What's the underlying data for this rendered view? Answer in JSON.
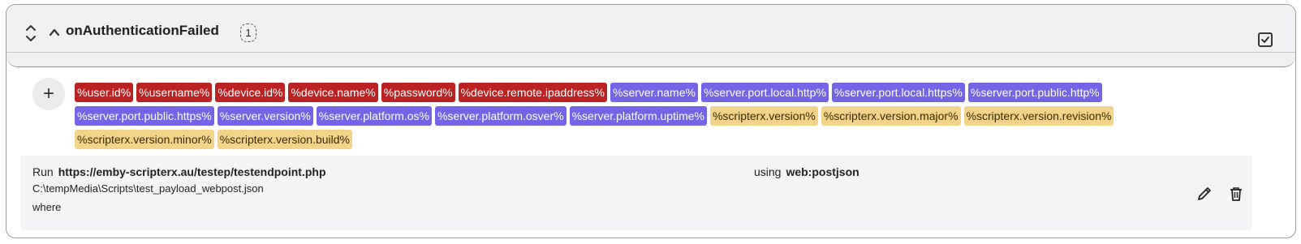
{
  "header": {
    "title": "onAuthenticationFailed",
    "count": "1",
    "icons": {
      "expand": "expand-collapse-icon",
      "collapse": "chevron-up-icon",
      "select": "checkbox-checked-icon"
    }
  },
  "tokens": {
    "add_label": "+",
    "items": [
      {
        "label": "%user.id%",
        "color": "#bd2222"
      },
      {
        "label": "%username%",
        "color": "#bd2222"
      },
      {
        "label": "%device.id%",
        "color": "#bd2222"
      },
      {
        "label": "%device.name%",
        "color": "#bd2222"
      },
      {
        "label": "%password%",
        "color": "#bd2222"
      },
      {
        "label": "%device.remote.ipaddress%",
        "color": "#bd2222"
      },
      {
        "label": "%server.name%",
        "color": "#7465e6"
      },
      {
        "label": "%server.port.local.http%",
        "color": "#7465e6"
      },
      {
        "label": "%server.port.local.https%",
        "color": "#7465e6"
      },
      {
        "label": "%server.port.public.http%",
        "color": "#7465e6"
      },
      {
        "label": "%server.port.public.https%",
        "color": "#7465e6"
      },
      {
        "label": "%server.version%",
        "color": "#7465e6"
      },
      {
        "label": "%server.platform.os%",
        "color": "#7465e6"
      },
      {
        "label": "%server.platform.osver%",
        "color": "#7465e6"
      },
      {
        "label": "%server.platform.uptime%",
        "color": "#7465e6"
      },
      {
        "label": "%scripterx.version%",
        "color": "#f3d28a"
      },
      {
        "label": "%scripterx.version.major%",
        "color": "#f3d28a"
      },
      {
        "label": "%scripterx.version.revision%",
        "color": "#f3d28a"
      },
      {
        "label": "%scripterx.version.minor%",
        "color": "#f3d28a"
      },
      {
        "label": "%scripterx.version.build%",
        "color": "#f3d28a"
      }
    ]
  },
  "action": {
    "run_label": "Run",
    "run_url": "https://emby-scripterx.au/testep/testendpoint.php",
    "using_label": "using",
    "using_value": "web:postjson",
    "path": "C:\\tempMedia\\Scripts\\test_payload_webpost.json",
    "where_label": "where",
    "icons": {
      "edit": "pencil-icon",
      "delete": "trash-icon"
    }
  }
}
